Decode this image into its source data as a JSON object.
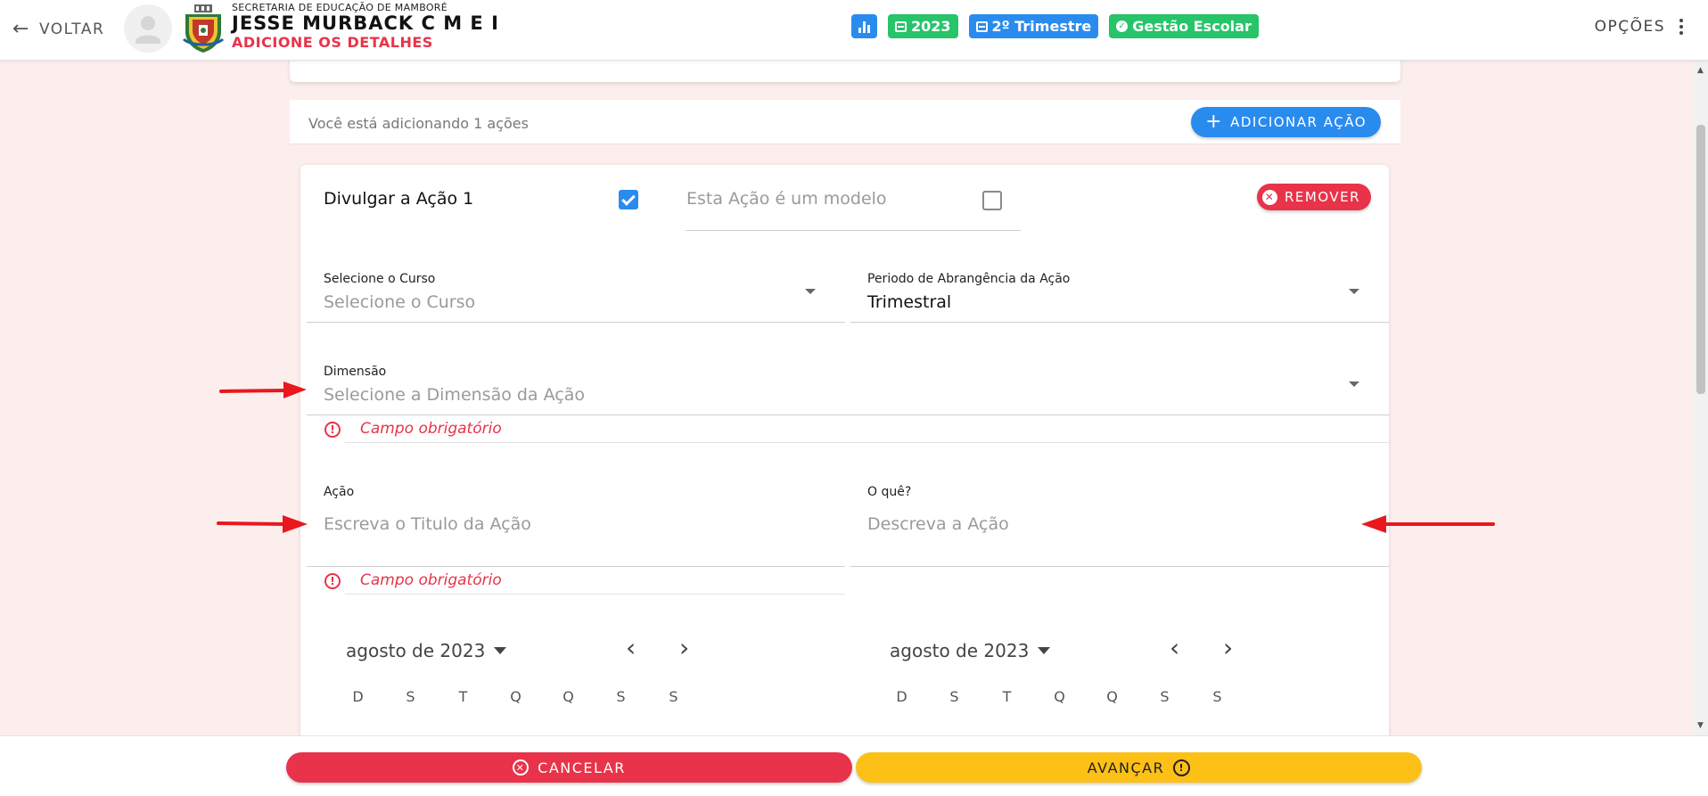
{
  "header": {
    "back_label": "VOLTAR",
    "secretaria": "SECRETARIA DE EDUCAÇÃO DE MAMBORÉ",
    "school_name": "JESSE MURBACK C M E I",
    "subtitle": "ADICIONE OS DETALHES",
    "chips": [
      {
        "icon": "chart-icon",
        "label": ""
      },
      {
        "icon": "calendar-icon",
        "label": "2023"
      },
      {
        "icon": "calendar-icon",
        "label": "2º Trimestre"
      },
      {
        "icon": "check-circle-icon",
        "label": "Gestão Escolar"
      }
    ],
    "options_label": "OPÇÕES"
  },
  "adding": {
    "text": "Você está adicionando 1 ações",
    "add_button": "ADICIONAR AÇÃO"
  },
  "action_card": {
    "publish_label": "Divulgar a Ação 1",
    "publish_checked": true,
    "model_label": "Esta Ação é um modelo",
    "model_checked": false,
    "remove_button": "REMOVER",
    "course": {
      "label": "Selecione o Curso",
      "placeholder": "Selecione o Curso"
    },
    "period": {
      "label": "Periodo de Abrangência da Ação",
      "value": "Trimestral"
    },
    "dimension": {
      "label": "Dimensão",
      "placeholder": "Selecione a Dimensão da Ação",
      "error": "Campo obrigatório"
    },
    "action": {
      "label": "Ação",
      "placeholder": "Escreva o Titulo da Ação",
      "error": "Campo obrigatório"
    },
    "what": {
      "label": "O quê?",
      "placeholder": "Descreva a Ação"
    },
    "calendars": [
      {
        "month": "agosto de 2023",
        "weekdays": [
          "D",
          "S",
          "T",
          "Q",
          "Q",
          "S",
          "S"
        ]
      },
      {
        "month": "agosto de 2023",
        "weekdays": [
          "D",
          "S",
          "T",
          "Q",
          "Q",
          "S",
          "S"
        ]
      }
    ]
  },
  "footer": {
    "cancel": "CANCELAR",
    "next": "AVANÇAR"
  },
  "colors": {
    "accent_blue": "#2a8bef",
    "accent_green": "#27c46a",
    "danger_red": "#e8334a",
    "warning_yellow": "#fdc016",
    "page_background": "#fdeeee"
  }
}
